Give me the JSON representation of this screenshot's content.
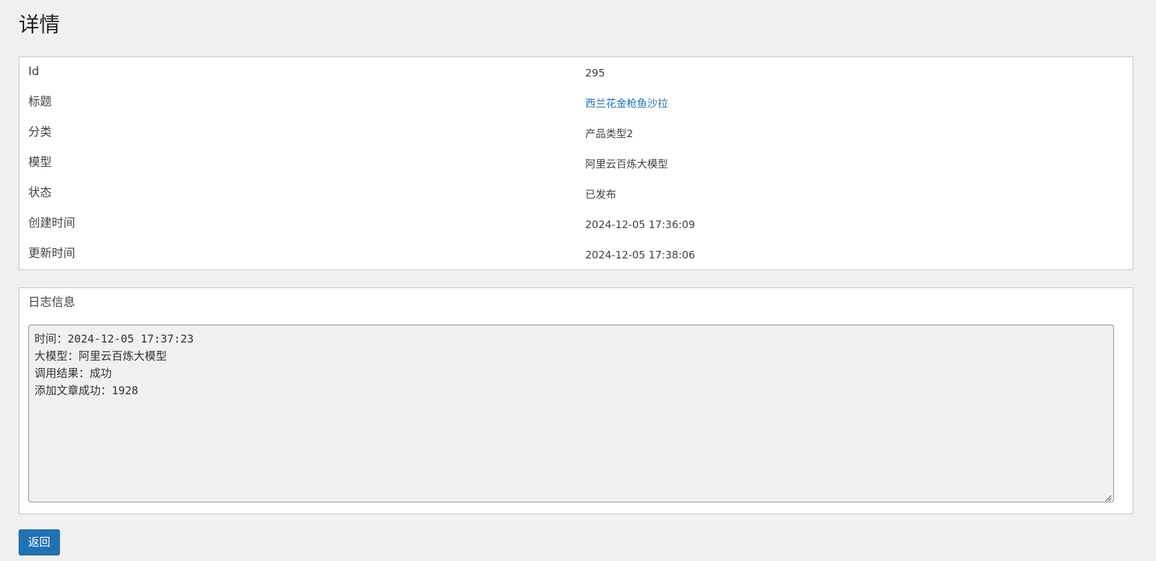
{
  "page": {
    "title": "详情"
  },
  "details": {
    "rows": [
      {
        "label": "Id",
        "value": "295"
      },
      {
        "label": "标题",
        "value": "西兰花金枪鱼沙拉"
      },
      {
        "label": "分类",
        "value": "产品类型2"
      },
      {
        "label": "模型",
        "value": "阿里云百炼大模型"
      },
      {
        "label": "状态",
        "value": "已发布"
      },
      {
        "label": "创建时间",
        "value": "2024-12-05 17:36:09"
      },
      {
        "label": "更新时间",
        "value": "2024-12-05 17:38:06"
      }
    ]
  },
  "log": {
    "title": "日志信息",
    "content": "时间：2024-12-05 17:37:23\n大模型：阿里云百炼大模型\n调用结果：成功\n添加文章成功：1928"
  },
  "actions": {
    "back_label": "返回"
  },
  "colors": {
    "background": "#f0f0f1",
    "card": "#ffffff",
    "border": "#c3c4c7",
    "link": "#2271b1",
    "primary_button": "#2271b1"
  }
}
